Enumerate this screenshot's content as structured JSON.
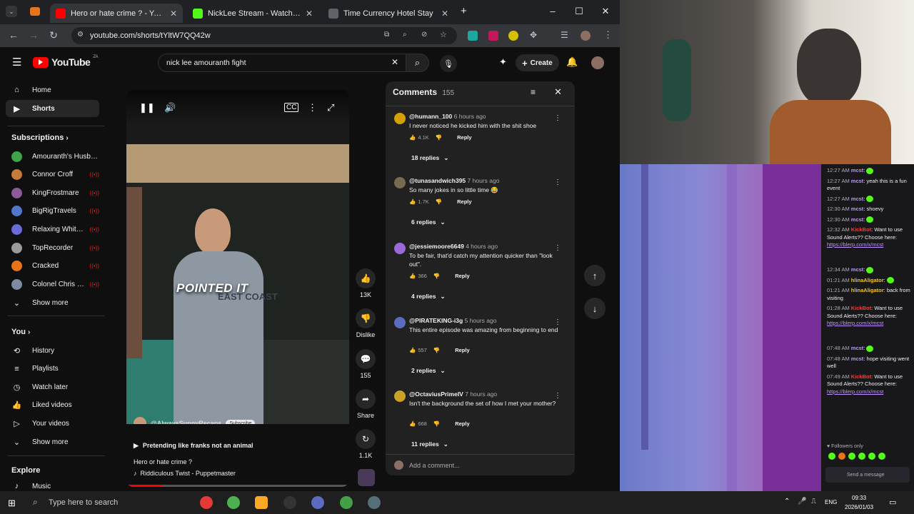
{
  "browser": {
    "tabs": [
      {
        "title": "Hero or hate crime ? - YouTube",
        "color": "#ff0000",
        "active": true
      },
      {
        "title": "NickLee Stream - Watch Live",
        "color": "#53fc18",
        "active": false
      },
      {
        "title": "Time Currency Hotel Stay",
        "color": "#5f6368",
        "active": false
      }
    ],
    "url": "youtube.com/shorts/tYltW7QQ42w"
  },
  "youtube": {
    "logo": "YouTube",
    "country": "ZA",
    "search_value": "nick lee amouranth fight",
    "create_label": "Create"
  },
  "sidebar": {
    "top": [
      {
        "label": "Home",
        "icon": "home-icon"
      },
      {
        "label": "Shorts",
        "icon": "shorts-icon",
        "selected": true
      }
    ],
    "subscriptions_header": "Subscriptions",
    "subscriptions": [
      {
        "label": "Amouranth's Husba...",
        "color": "#3ea34a",
        "live": false
      },
      {
        "label": "Connor Croff",
        "color": "#c77b3a",
        "live": true
      },
      {
        "label": "KingFrostmare",
        "color": "#8a5a9a",
        "live": true
      },
      {
        "label": "BigRigTravels",
        "color": "#5276c9",
        "live": true
      },
      {
        "label": "Relaxing White N...",
        "color": "#6a6ad8",
        "live": true
      },
      {
        "label": "TopRecorder",
        "color": "#9a9a9a",
        "live": true
      },
      {
        "label": "Cracked",
        "color": "#e8741a",
        "live": true
      },
      {
        "label": "Colonel Chris Wy...",
        "color": "#7d8ca0",
        "live": true
      }
    ],
    "show_more_1": "Show more",
    "you_header": "You",
    "you": [
      {
        "label": "History",
        "icon": "history-icon"
      },
      {
        "label": "Playlists",
        "icon": "playlists-icon"
      },
      {
        "label": "Watch later",
        "icon": "watch-later-icon"
      },
      {
        "label": "Liked videos",
        "icon": "liked-videos-icon"
      },
      {
        "label": "Your videos",
        "icon": "your-videos-icon"
      }
    ],
    "show_more_2": "Show more",
    "explore_header": "Explore",
    "music": "Music"
  },
  "short": {
    "overlay_text": "POINTED IT",
    "channel": "@AlwaysSunnyRecaps",
    "subscribe": "Subscribe",
    "caption_line": "Pretending like franks not an animal",
    "title": "Hero or hate crime ?",
    "sound": "Riddiculous Twist - Puppetmaster",
    "progress": 0.16,
    "likes": "13K",
    "dislike": "Dislike",
    "comments": "155",
    "share": "Share",
    "remix": "1.1K"
  },
  "comments_panel": {
    "title": "Comments",
    "count": "155",
    "add_placeholder": "Add a comment...",
    "reply_label": "Reply",
    "items": [
      {
        "handle": "@humann_100",
        "time": "6 hours ago",
        "text": "I never noticed he kicked him with the shit shoe",
        "likes": "4.1K",
        "replies": "18 replies",
        "color": "#d4a000"
      },
      {
        "handle": "@tunasandwich395",
        "time": "7 hours ago",
        "text": "So many jokes in so little time 😂",
        "likes": "1.7K",
        "replies": "6 replies",
        "color": "#7a6a50"
      },
      {
        "handle": "@jessiemoore6649",
        "time": "4 hours ago",
        "text": "To be fair, that'd catch my attention quicker than \"look out\".",
        "likes": "366",
        "replies": "4 replies",
        "color": "#9b6ad8"
      },
      {
        "handle": "@PIRATEKING-i3g",
        "time": "5 hours ago",
        "text": "This entire episode was amazing from beginning to end",
        "likes": "557",
        "replies": "2 replies",
        "color": "#5c6bc0"
      },
      {
        "handle": "@OctaviusPrimeIV",
        "time": "7 hours ago",
        "text": "Isn't the background the set of how I met your mother?",
        "likes": "668",
        "replies": "11 replies",
        "color": "#c9a227"
      }
    ]
  },
  "stream_chat": {
    "lines": [
      {
        "ts": "12:27 AM",
        "name": "mcst",
        "color": "#bf94ff",
        "text": ""
      },
      {
        "ts": "12:27 AM",
        "name": "mcst",
        "color": "#bf94ff",
        "text": "yeah this is a fun event"
      },
      {
        "ts": "12:27 AM",
        "name": "mcst",
        "color": "#bf94ff",
        "text": ""
      },
      {
        "ts": "12:30 AM",
        "name": "mcst",
        "color": "#bf94ff",
        "text": "shoevy"
      },
      {
        "ts": "12:30 AM",
        "name": "mcst",
        "color": "#bf94ff",
        "text": ""
      },
      {
        "ts": "12:32 AM",
        "name": "KickBot",
        "color": "#e64141",
        "text": "Want to use Sound Alerts?? Choose here:",
        "link": "https://blerp.com/x/mcst"
      },
      {
        "ts": "12:34 AM",
        "name": "mcst",
        "color": "#bf94ff",
        "text": ""
      },
      {
        "ts": "01:21 AM",
        "name": "hlinaAligator",
        "color": "#f5c518",
        "text": ""
      },
      {
        "ts": "01:21 AM",
        "name": "hlinaAligator",
        "color": "#f5c518",
        "text": "back from visiting"
      },
      {
        "ts": "01:28 AM",
        "name": "KickBot",
        "color": "#e64141",
        "text": "Want to use Sound Alerts?? Choose here:",
        "link": "https://blerp.com/x/mcst"
      },
      {
        "ts": "07:48 AM",
        "name": "mcst",
        "color": "#bf94ff",
        "text": ""
      },
      {
        "ts": "07:48 AM",
        "name": "mcst",
        "color": "#bf94ff",
        "text": "hope visiting went well"
      },
      {
        "ts": "07:49 AM",
        "name": "KickBot",
        "color": "#e64141",
        "text": "Want to use Sound Alerts?? Choose here:",
        "link": "https://blerp.com/x/mcst"
      }
    ],
    "followers_only": "Followers only",
    "send_placeholder": "Send a message"
  },
  "taskbar": {
    "search_placeholder": "Type here to search",
    "lang": "ENG",
    "time": "09:33",
    "date": "2026/01/03"
  }
}
